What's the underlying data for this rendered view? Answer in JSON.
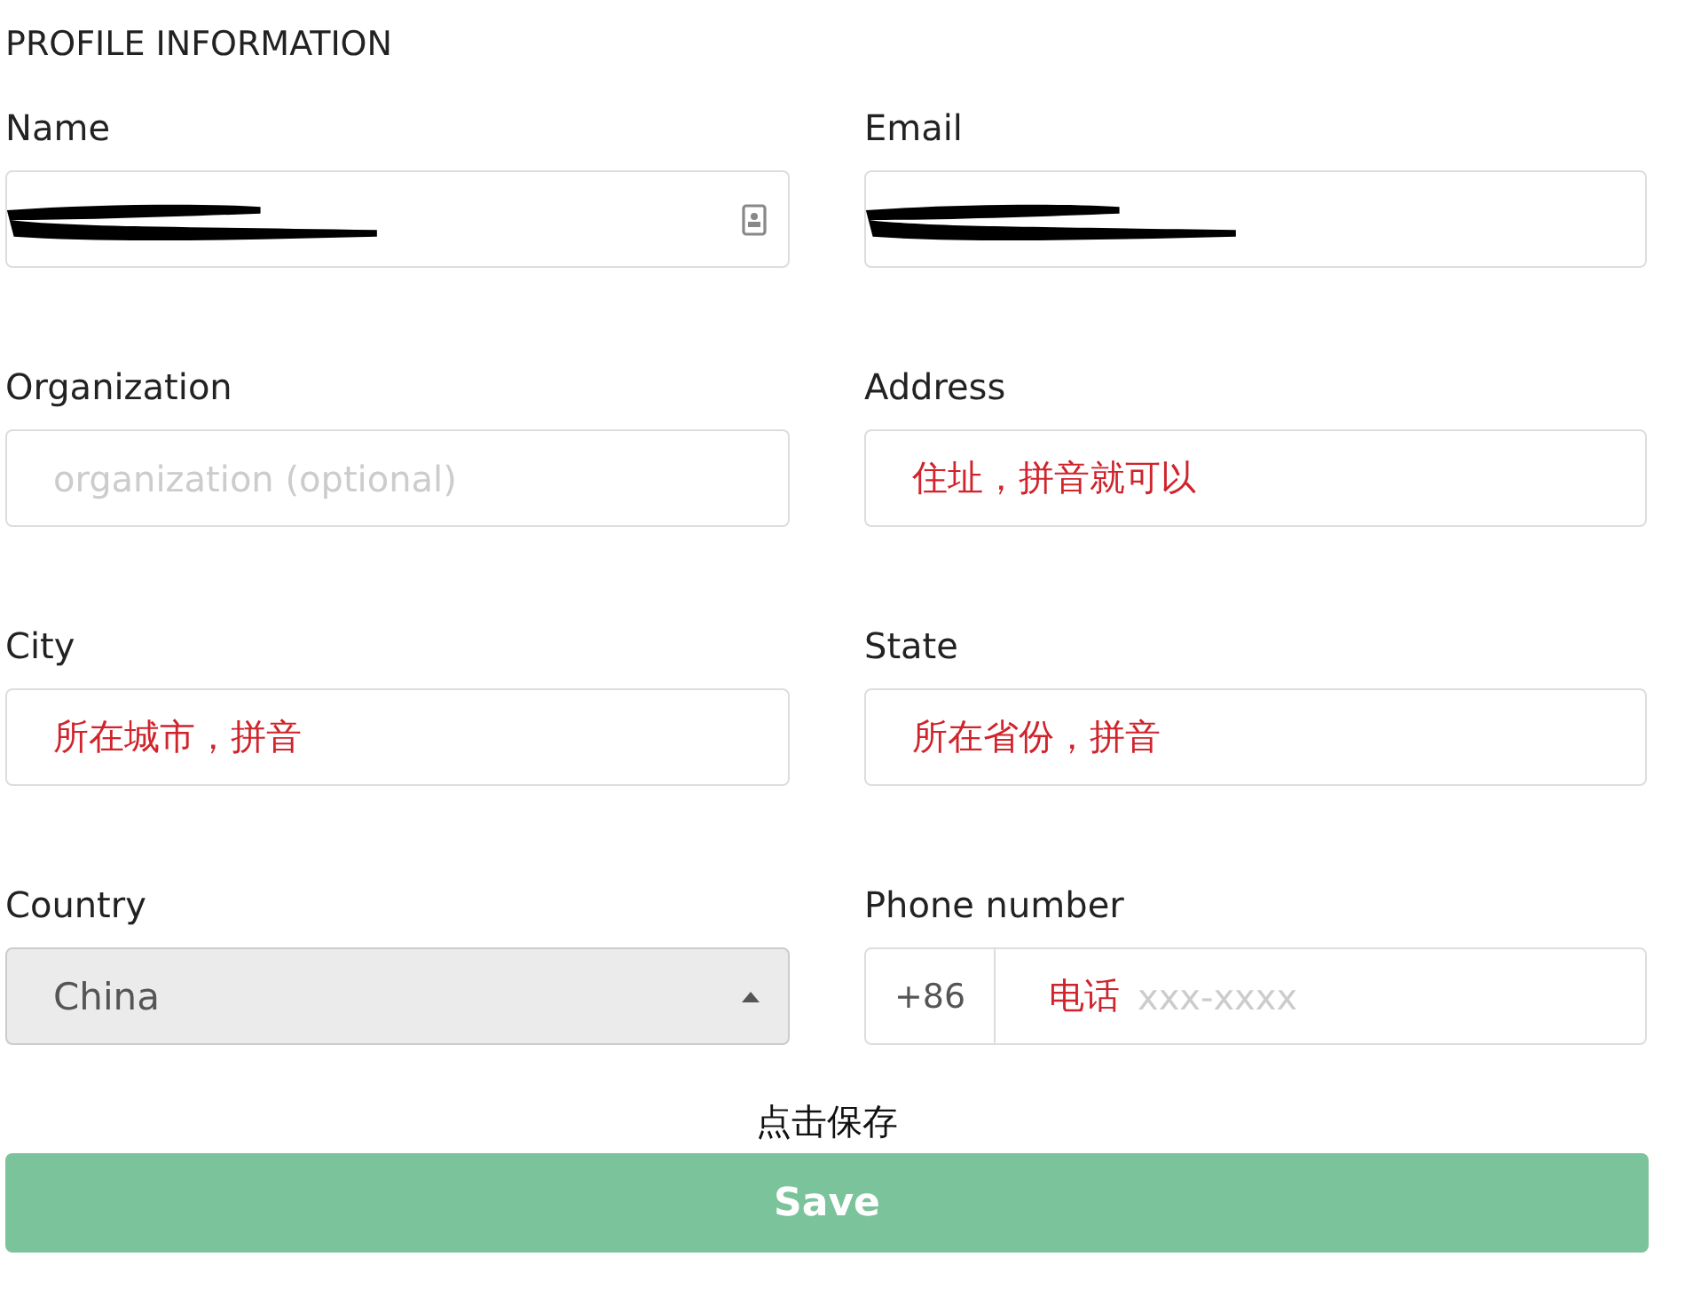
{
  "section_title": "PROFILE INFORMATION",
  "fields": [
    {
      "kind": "text",
      "label": "Name",
      "redacted": true,
      "icon": true
    },
    {
      "kind": "text",
      "label": "Email",
      "redacted": true
    },
    {
      "kind": "text",
      "label": "Organization",
      "placeholder": "organization (optional)"
    },
    {
      "kind": "text",
      "label": "Address",
      "note": "住址，拼音就可以"
    },
    {
      "kind": "text",
      "label": "City",
      "note": "所在城市，拼音"
    },
    {
      "kind": "text",
      "label": "State",
      "note": "所在省份，拼音"
    },
    {
      "kind": "select",
      "label": "Country",
      "value": "China",
      "disabled": true
    },
    {
      "kind": "phone",
      "label": "Phone number",
      "prefix": "+86",
      "note": "电话",
      "placeholder": "xxx-xxxx"
    }
  ],
  "save_hint": "点击保存",
  "save_button": "Save"
}
